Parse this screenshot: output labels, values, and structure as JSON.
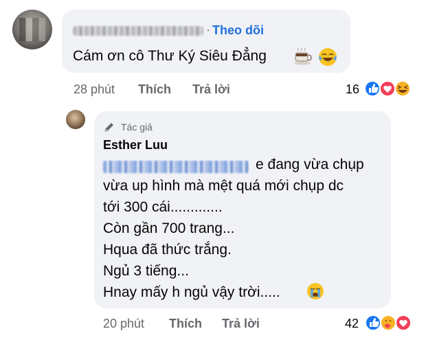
{
  "comment1": {
    "follow_label": "Theo dõi",
    "separator": "·",
    "text": "Cám ơn cô Thư Ký Siêu Đẳng",
    "time": "28 phút",
    "like_label": "Thích",
    "reply_label": "Trả lời",
    "reaction_count": "16",
    "reactions": [
      "like-icon",
      "love-icon",
      "haha-icon"
    ]
  },
  "comment2": {
    "badge_label": "Tác giả",
    "author": "Esther Luu",
    "lines": [
      "e đang vừa chụp",
      "vừa up hình mà mệt quá mới chụp dc",
      "tới 300 cái.............",
      "Còn gần 700 trang...",
      "Hqua đã thức trắng.",
      "Ngủ 3 tiếng...",
      "Hnay mấy h ngủ vậy trời....."
    ],
    "time": "20 phút",
    "like_label": "Thích",
    "reply_label": "Trả lời",
    "reaction_count": "42",
    "reactions": [
      "like-icon",
      "care-icon",
      "love-icon"
    ]
  },
  "colors": {
    "link_blue": "#216fdb",
    "bubble_bg": "#f0f2f5",
    "meta_gray": "#65676b",
    "like_blue": "#1877f2",
    "love_red": "#f33e58",
    "haha_yellow": "#f7b125"
  }
}
